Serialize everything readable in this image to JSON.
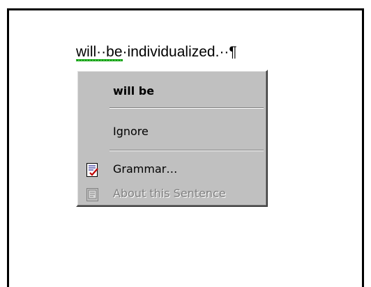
{
  "document": {
    "word1": "will",
    "sep1": "··",
    "word2": "be",
    "rest": "·individualized.··¶"
  },
  "context_menu": {
    "suggestion": "will be",
    "ignore_label": "Ignore",
    "grammar_label": "Grammar…",
    "about_label": "About this Sentence",
    "grammar_icon": "grammar-check-icon",
    "about_icon": "about-sentence-icon",
    "disabled_color": "#808080",
    "menu_color": "#c0c0c0",
    "squiggle_color": "#00a000"
  }
}
